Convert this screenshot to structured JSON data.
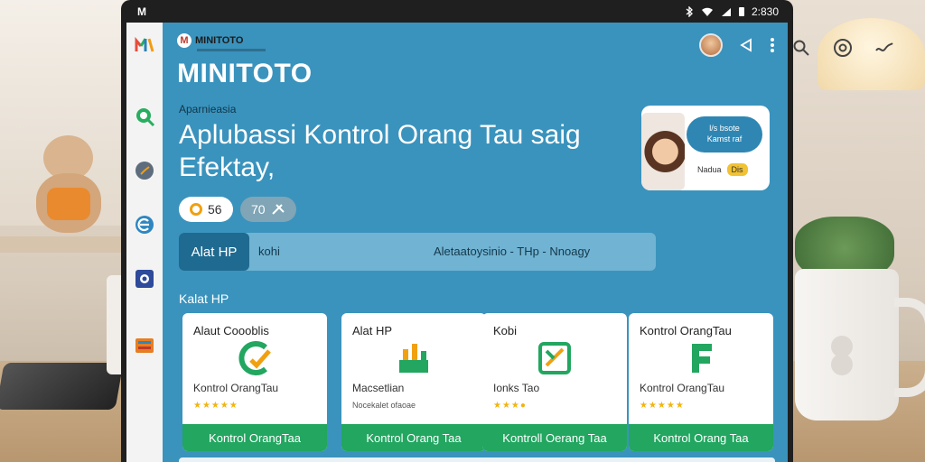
{
  "status_bar": {
    "left_text": "M",
    "time": "2:830"
  },
  "brand": {
    "name": "MINITOTO"
  },
  "app_title": "MINITOTO",
  "hero": {
    "overline": "Aparnieasia",
    "headline": "Aplubassi Kontrol Orang Tau saig Efektay,"
  },
  "promo_card": {
    "pill_line1": "l/s bsote",
    "pill_line2": "Kamst raf",
    "footer_text": "Nadua",
    "badge": "Dis"
  },
  "chips": [
    {
      "label": "56"
    },
    {
      "label": "70"
    }
  ],
  "search": {
    "button_label": "Alat HP",
    "query": "kohi",
    "hint": "Aletaatoysinio - THp - Nnoagy"
  },
  "section_label": "Kalat HP",
  "cards": [
    {
      "title": "Alaut Coooblis",
      "subtitle": "Kontrol OrangTau",
      "rating": "★★★★★",
      "cta": "Kontrol OrangTaa",
      "icon": "c-check-icon"
    },
    {
      "title": "Alat HP",
      "subtitle": "Macsetlian",
      "rating": "Nocekalet ofaoae",
      "cta": "Kontrol Orang Taa",
      "icon": "factory-chart-icon"
    },
    {
      "title": "Kobi",
      "subtitle": "Ionks Tao",
      "rating": "★★★●",
      "cta": "Kontroll Oerang Taa",
      "icon": "edit-box-icon"
    },
    {
      "title": "Kontrol OrangTau",
      "subtitle": "Kontrol OrangTau",
      "rating": "★★★★★",
      "cta": "Kontrol Orang Taa",
      "icon": "f-letter-icon"
    }
  ],
  "colors": {
    "screen_bg": "#3a93bd",
    "accent_dark": "#1f6a91",
    "cta_green": "#22a660",
    "star_yellow": "#f1b410"
  }
}
